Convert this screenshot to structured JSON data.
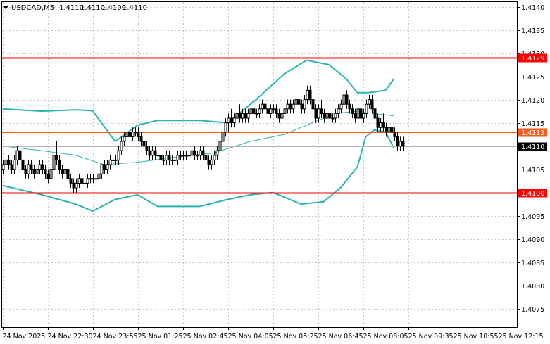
{
  "header": {
    "symbol": "USDCAD,M5",
    "open": "1.4110",
    "high": "1.4110",
    "low": "1.4109",
    "close": "1.4110"
  },
  "colors": {
    "background": "#ffffff",
    "grid": "#c8c8c8",
    "candle": "#000000",
    "bands": "#2bb5b0",
    "level_red": "#ff0000",
    "level_orange": "#ff5a1e",
    "price_badge": "#000000"
  },
  "chart_data": {
    "type": "candlestick",
    "y_range": [
      1.4071,
      1.4141
    ],
    "y_ticks": [
      "1.4140",
      "1.4135",
      "1.4130",
      "1.4125",
      "1.4120",
      "1.4115",
      "1.4110",
      "1.4105",
      "1.4100",
      "1.4095",
      "1.4090",
      "1.4085",
      "1.4080",
      "1.4075"
    ],
    "x_ticks": [
      "24 Nov 2025",
      "24 Nov 22:30",
      "24 Nov 23:55",
      "25 Nov 01:25",
      "25 Nov 02:45",
      "25 Nov 04:05",
      "25 Nov 05:25",
      "25 Nov 06:45",
      "25 Nov 08:05",
      "25 Nov 09:35",
      "25 Nov 10:55",
      "25 Nov 12:15"
    ],
    "levels": [
      {
        "label": "1.4129",
        "value": 1.4129,
        "style": "red"
      },
      {
        "label": "1.4113",
        "value": 1.4113,
        "style": "orange"
      },
      {
        "label": "1.4100",
        "value": 1.41,
        "style": "red"
      }
    ],
    "current_price": {
      "label": "1.4110",
      "value": 1.411
    },
    "crosshair_x_label": "24 Nov 23:55",
    "bars_per_tick": 16,
    "candles": [
      [
        1.4105,
        1.4107,
        1.4104,
        1.4106
      ],
      [
        1.4106,
        1.4108,
        1.4105,
        1.4107
      ],
      [
        1.4107,
        1.4108,
        1.4105,
        1.4106
      ],
      [
        1.4106,
        1.4107,
        1.4104,
        1.4105
      ],
      [
        1.4105,
        1.4108,
        1.4104,
        1.4107
      ],
      [
        1.4107,
        1.411,
        1.4106,
        1.4109
      ],
      [
        1.4109,
        1.411,
        1.4106,
        1.4107
      ],
      [
        1.4107,
        1.4108,
        1.4104,
        1.4105
      ],
      [
        1.4105,
        1.4106,
        1.4103,
        1.4104
      ],
      [
        1.4104,
        1.4107,
        1.4103,
        1.4106
      ],
      [
        1.4106,
        1.4107,
        1.4104,
        1.4105
      ],
      [
        1.4105,
        1.4106,
        1.4103,
        1.4104
      ],
      [
        1.4104,
        1.4106,
        1.4103,
        1.4105
      ],
      [
        1.4105,
        1.4107,
        1.4104,
        1.4106
      ],
      [
        1.4106,
        1.4107,
        1.4104,
        1.4105
      ],
      [
        1.4105,
        1.4106,
        1.4103,
        1.4104
      ],
      [
        1.4104,
        1.4105,
        1.4102,
        1.4103
      ],
      [
        1.4103,
        1.4106,
        1.4102,
        1.4105
      ],
      [
        1.4105,
        1.4109,
        1.4104,
        1.4108
      ],
      [
        1.4108,
        1.4111,
        1.4106,
        1.4107
      ],
      [
        1.4107,
        1.4108,
        1.4104,
        1.4105
      ],
      [
        1.4105,
        1.4106,
        1.4103,
        1.4104
      ],
      [
        1.4104,
        1.4106,
        1.4103,
        1.4105
      ],
      [
        1.4105,
        1.4106,
        1.4102,
        1.4103
      ],
      [
        1.4103,
        1.4104,
        1.4101,
        1.4102
      ],
      [
        1.4102,
        1.4103,
        1.41,
        1.4101
      ],
      [
        1.4101,
        1.4103,
        1.41,
        1.4102
      ],
      [
        1.4102,
        1.4104,
        1.4101,
        1.4103
      ],
      [
        1.4103,
        1.4104,
        1.4101,
        1.4102
      ],
      [
        1.4102,
        1.4103,
        1.4101,
        1.4102
      ],
      [
        1.4102,
        1.4104,
        1.4101,
        1.4103
      ],
      [
        1.4103,
        1.4104,
        1.4102,
        1.4103
      ],
      [
        1.4103,
        1.4104,
        1.4102,
        1.4103
      ],
      [
        1.4103,
        1.4104,
        1.4102,
        1.4103
      ],
      [
        1.4103,
        1.4105,
        1.4102,
        1.4104
      ],
      [
        1.4104,
        1.4106,
        1.4103,
        1.4106
      ],
      [
        1.4106,
        1.4107,
        1.4104,
        1.4105
      ],
      [
        1.4105,
        1.4107,
        1.4104,
        1.4106
      ],
      [
        1.4106,
        1.4108,
        1.4105,
        1.4107
      ],
      [
        1.4107,
        1.4108,
        1.4106,
        1.4107
      ],
      [
        1.4107,
        1.4108,
        1.4106,
        1.4107
      ],
      [
        1.4107,
        1.411,
        1.4106,
        1.4109
      ],
      [
        1.4109,
        1.4112,
        1.4108,
        1.4111
      ],
      [
        1.4111,
        1.4113,
        1.411,
        1.4112
      ],
      [
        1.4112,
        1.4114,
        1.4111,
        1.4113
      ],
      [
        1.4113,
        1.4114,
        1.4111,
        1.4112
      ],
      [
        1.4112,
        1.4114,
        1.4111,
        1.4113
      ],
      [
        1.4113,
        1.4114,
        1.4112,
        1.4113
      ],
      [
        1.4113,
        1.4114,
        1.4111,
        1.4112
      ],
      [
        1.4112,
        1.4113,
        1.411,
        1.4111
      ],
      [
        1.4111,
        1.4112,
        1.4109,
        1.411
      ],
      [
        1.411,
        1.4111,
        1.4108,
        1.4109
      ],
      [
        1.4109,
        1.411,
        1.4107,
        1.4108
      ],
      [
        1.4108,
        1.411,
        1.4107,
        1.4109
      ],
      [
        1.4109,
        1.411,
        1.4107,
        1.4108
      ],
      [
        1.4108,
        1.4109,
        1.4107,
        1.4108
      ],
      [
        1.4108,
        1.4109,
        1.4106,
        1.4107
      ],
      [
        1.4107,
        1.4108,
        1.4106,
        1.4107
      ],
      [
        1.4107,
        1.4109,
        1.4106,
        1.4108
      ],
      [
        1.4108,
        1.4109,
        1.4106,
        1.4107
      ],
      [
        1.4107,
        1.4108,
        1.4106,
        1.4107
      ],
      [
        1.4107,
        1.4108,
        1.4106,
        1.4107
      ],
      [
        1.4107,
        1.4109,
        1.4106,
        1.4108
      ],
      [
        1.4108,
        1.4109,
        1.4107,
        1.4108
      ],
      [
        1.4108,
        1.4109,
        1.4107,
        1.4108
      ],
      [
        1.4108,
        1.4109,
        1.4107,
        1.4108
      ],
      [
        1.4108,
        1.4109,
        1.4107,
        1.4108
      ],
      [
        1.4108,
        1.411,
        1.4107,
        1.4109
      ],
      [
        1.4109,
        1.411,
        1.4107,
        1.4108
      ],
      [
        1.4108,
        1.4109,
        1.4107,
        1.4108
      ],
      [
        1.4108,
        1.411,
        1.4107,
        1.4109
      ],
      [
        1.4109,
        1.411,
        1.4107,
        1.4108
      ],
      [
        1.4108,
        1.4109,
        1.4106,
        1.4107
      ],
      [
        1.4107,
        1.4108,
        1.4105,
        1.4106
      ],
      [
        1.4106,
        1.4108,
        1.4105,
        1.4107
      ],
      [
        1.4107,
        1.4109,
        1.4106,
        1.4108
      ],
      [
        1.4108,
        1.411,
        1.4107,
        1.4109
      ],
      [
        1.4109,
        1.4112,
        1.4108,
        1.4111
      ],
      [
        1.4111,
        1.4114,
        1.411,
        1.4113
      ],
      [
        1.4113,
        1.4116,
        1.4112,
        1.4115
      ],
      [
        1.4115,
        1.4117,
        1.4113,
        1.4116
      ],
      [
        1.4116,
        1.4118,
        1.4114,
        1.4115
      ],
      [
        1.4115,
        1.4117,
        1.4114,
        1.4116
      ],
      [
        1.4116,
        1.4118,
        1.4115,
        1.4117
      ],
      [
        1.4117,
        1.4119,
        1.4115,
        1.4116
      ],
      [
        1.4116,
        1.4118,
        1.4115,
        1.4117
      ],
      [
        1.4117,
        1.4118,
        1.4115,
        1.4116
      ],
      [
        1.4116,
        1.4118,
        1.4115,
        1.4117
      ],
      [
        1.4117,
        1.4119,
        1.4116,
        1.4118
      ],
      [
        1.4118,
        1.4119,
        1.4116,
        1.4117
      ],
      [
        1.4117,
        1.4118,
        1.4116,
        1.4117
      ],
      [
        1.4117,
        1.4119,
        1.4116,
        1.4118
      ],
      [
        1.4118,
        1.412,
        1.4117,
        1.4119
      ],
      [
        1.4119,
        1.412,
        1.4117,
        1.4118
      ],
      [
        1.4118,
        1.4119,
        1.4116,
        1.4117
      ],
      [
        1.4117,
        1.4119,
        1.4116,
        1.4118
      ],
      [
        1.4118,
        1.4119,
        1.4117,
        1.4118
      ],
      [
        1.4118,
        1.4119,
        1.4116,
        1.4117
      ],
      [
        1.4117,
        1.4118,
        1.4115,
        1.4116
      ],
      [
        1.4116,
        1.4118,
        1.4115,
        1.4117
      ],
      [
        1.4117,
        1.4119,
        1.4116,
        1.4118
      ],
      [
        1.4118,
        1.412,
        1.4117,
        1.4119
      ],
      [
        1.4119,
        1.412,
        1.4117,
        1.4118
      ],
      [
        1.4118,
        1.412,
        1.4117,
        1.4119
      ],
      [
        1.4119,
        1.4121,
        1.4118,
        1.412
      ],
      [
        1.412,
        1.4122,
        1.4118,
        1.4119
      ],
      [
        1.4119,
        1.412,
        1.4117,
        1.4118
      ],
      [
        1.4118,
        1.4121,
        1.4117,
        1.412
      ],
      [
        1.412,
        1.4123,
        1.4119,
        1.4122
      ],
      [
        1.4122,
        1.4123,
        1.4119,
        1.412
      ],
      [
        1.412,
        1.4121,
        1.4117,
        1.4118
      ],
      [
        1.4118,
        1.4119,
        1.4115,
        1.4116
      ],
      [
        1.4116,
        1.4119,
        1.4115,
        1.4118
      ],
      [
        1.4118,
        1.412,
        1.4116,
        1.4117
      ],
      [
        1.4117,
        1.4118,
        1.4115,
        1.4116
      ],
      [
        1.4116,
        1.4118,
        1.4115,
        1.4117
      ],
      [
        1.4117,
        1.4118,
        1.4115,
        1.4116
      ],
      [
        1.4116,
        1.4117,
        1.4115,
        1.4116
      ],
      [
        1.4116,
        1.4118,
        1.4115,
        1.4117
      ],
      [
        1.4117,
        1.4119,
        1.4116,
        1.4118
      ],
      [
        1.4118,
        1.412,
        1.4117,
        1.4119
      ],
      [
        1.4119,
        1.4122,
        1.4118,
        1.4121
      ],
      [
        1.4121,
        1.4122,
        1.4118,
        1.4119
      ],
      [
        1.4119,
        1.412,
        1.4117,
        1.4118
      ],
      [
        1.4118,
        1.4119,
        1.4116,
        1.4117
      ],
      [
        1.4117,
        1.4118,
        1.4115,
        1.4116
      ],
      [
        1.4116,
        1.4119,
        1.4115,
        1.4118
      ],
      [
        1.4118,
        1.4119,
        1.4115,
        1.4116
      ],
      [
        1.4116,
        1.4118,
        1.4115,
        1.4117
      ],
      [
        1.4117,
        1.412,
        1.4116,
        1.4119
      ],
      [
        1.4119,
        1.4121,
        1.4118,
        1.412
      ],
      [
        1.412,
        1.4121,
        1.4117,
        1.4118
      ],
      [
        1.4118,
        1.4119,
        1.4115,
        1.4116
      ],
      [
        1.4116,
        1.4117,
        1.4113,
        1.4114
      ],
      [
        1.4114,
        1.4116,
        1.4113,
        1.4115
      ],
      [
        1.4115,
        1.4117,
        1.4113,
        1.4114
      ],
      [
        1.4114,
        1.4115,
        1.4112,
        1.4113
      ],
      [
        1.4113,
        1.4115,
        1.4112,
        1.4114
      ],
      [
        1.4114,
        1.4115,
        1.4112,
        1.4113
      ],
      [
        1.4113,
        1.4114,
        1.4111,
        1.4112
      ],
      [
        1.4112,
        1.4113,
        1.4109,
        1.411
      ],
      [
        1.411,
        1.4112,
        1.4109,
        1.4111
      ],
      [
        1.4111,
        1.4112,
        1.4109,
        1.411
      ]
    ],
    "bollinger_upper": [
      [
        0,
        1.4118
      ],
      [
        14,
        1.41175
      ],
      [
        26,
        1.41178
      ],
      [
        32,
        1.41176
      ],
      [
        40,
        1.4111
      ],
      [
        48,
        1.41145
      ],
      [
        55,
        1.41155
      ],
      [
        70,
        1.41155
      ],
      [
        80,
        1.4115
      ],
      [
        90,
        1.412
      ],
      [
        100,
        1.41255
      ],
      [
        108,
        1.41285
      ],
      [
        116,
        1.41275
      ],
      [
        122,
        1.41245
      ],
      [
        126,
        1.41215
      ],
      [
        130,
        1.41215
      ],
      [
        136,
        1.4122
      ],
      [
        139,
        1.41245
      ]
    ],
    "bollinger_middle": [
      [
        0,
        1.411
      ],
      [
        14,
        1.4109
      ],
      [
        26,
        1.4108
      ],
      [
        36,
        1.4106
      ],
      [
        48,
        1.41065
      ],
      [
        60,
        1.41075
      ],
      [
        75,
        1.41085
      ],
      [
        88,
        1.4111
      ],
      [
        100,
        1.41125
      ],
      [
        110,
        1.4115
      ],
      [
        118,
        1.4117
      ],
      [
        126,
        1.41175
      ],
      [
        132,
        1.4117
      ],
      [
        139,
        1.41165
      ]
    ],
    "bollinger_lower": [
      [
        0,
        1.41015
      ],
      [
        14,
        1.40995
      ],
      [
        26,
        1.40975
      ],
      [
        32,
        1.4096
      ],
      [
        40,
        1.40985
      ],
      [
        48,
        1.40995
      ],
      [
        55,
        1.4097
      ],
      [
        70,
        1.4097
      ],
      [
        80,
        1.40985
      ],
      [
        88,
        1.40995
      ],
      [
        96,
        1.41
      ],
      [
        106,
        1.40975
      ],
      [
        114,
        1.4098
      ],
      [
        120,
        1.4101
      ],
      [
        126,
        1.41055
      ],
      [
        129,
        1.4112
      ],
      [
        132,
        1.41135
      ],
      [
        136,
        1.4113
      ],
      [
        139,
        1.41095
      ]
    ]
  }
}
